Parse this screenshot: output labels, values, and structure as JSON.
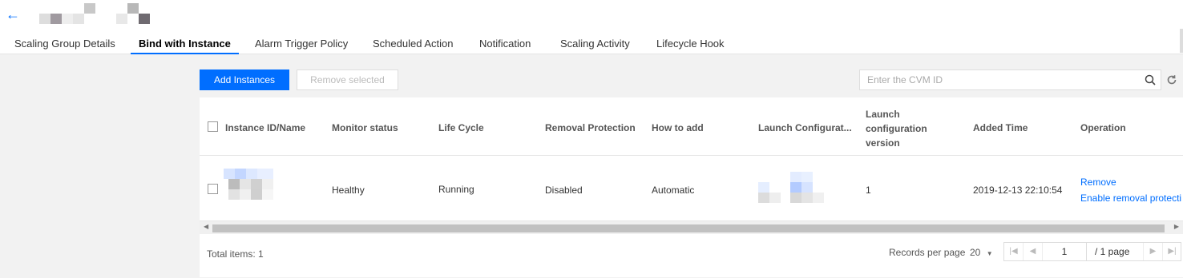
{
  "header": {
    "back_icon": "arrow-left-icon",
    "title": ""
  },
  "tabs": [
    {
      "label": "Scaling Group Details",
      "active": false
    },
    {
      "label": "Bind with Instance",
      "active": true
    },
    {
      "label": "Alarm Trigger Policy",
      "active": false
    },
    {
      "label": "Scheduled Action",
      "active": false
    },
    {
      "label": "Notification",
      "active": false
    },
    {
      "label": "Scaling Activity",
      "active": false
    },
    {
      "label": "Lifecycle Hook",
      "active": false
    }
  ],
  "toolbar": {
    "add_label": "Add Instances",
    "remove_label": "Remove selected",
    "search_placeholder": "Enter the CVM ID"
  },
  "table": {
    "columns": [
      "Instance ID/Name",
      "Monitor status",
      "Life Cycle",
      "Removal Protection",
      "How to add",
      "Launch Configurat...",
      "Launch configuration version",
      "Added Time",
      "Operation"
    ],
    "rows": [
      {
        "instance": "",
        "monitor_status": "Healthy",
        "life_cycle": "Running",
        "removal_protection": "Disabled",
        "how_to_add": "Automatic",
        "launch_config": "",
        "launch_config_version": "1",
        "added_time": "2019-12-13 22:10:54",
        "operations": [
          "Remove",
          "Enable removal protecti"
        ]
      }
    ]
  },
  "footer": {
    "total_label": "Total items: 1",
    "records_per_page_label": "Records per page",
    "page_size": "20",
    "current_page": "1",
    "page_total": "/ 1 page"
  },
  "colors": {
    "accent": "#006eff",
    "background": "#f2f2f2"
  }
}
